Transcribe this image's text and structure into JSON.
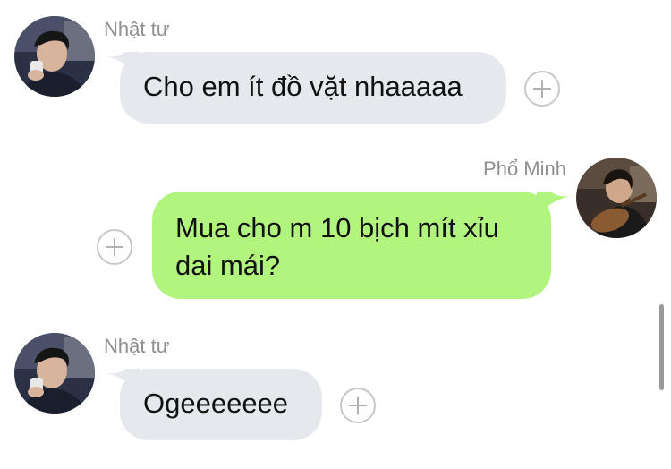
{
  "messages": [
    {
      "sender": "Nhật tư",
      "text": "Cho em ít đồ vặt nhaaaaa",
      "direction": "incoming",
      "avatar_icon": "user-avatar-icon"
    },
    {
      "sender": "Phổ Minh",
      "text": "Mua cho m 10 bịch mít xỉu dai mái?",
      "direction": "outgoing",
      "avatar_icon": "user-avatar-icon"
    },
    {
      "sender": "Nhật tư",
      "text": "Ogeeeeeee",
      "direction": "incoming",
      "avatar_icon": "user-avatar-icon"
    }
  ],
  "reaction_button_icon": "add-reaction-icon",
  "colors": {
    "incoming_bubble": "#e5e9ee",
    "outgoing_bubble": "#b2f57e",
    "sender_name": "#8e8e93",
    "text": "#111111"
  }
}
